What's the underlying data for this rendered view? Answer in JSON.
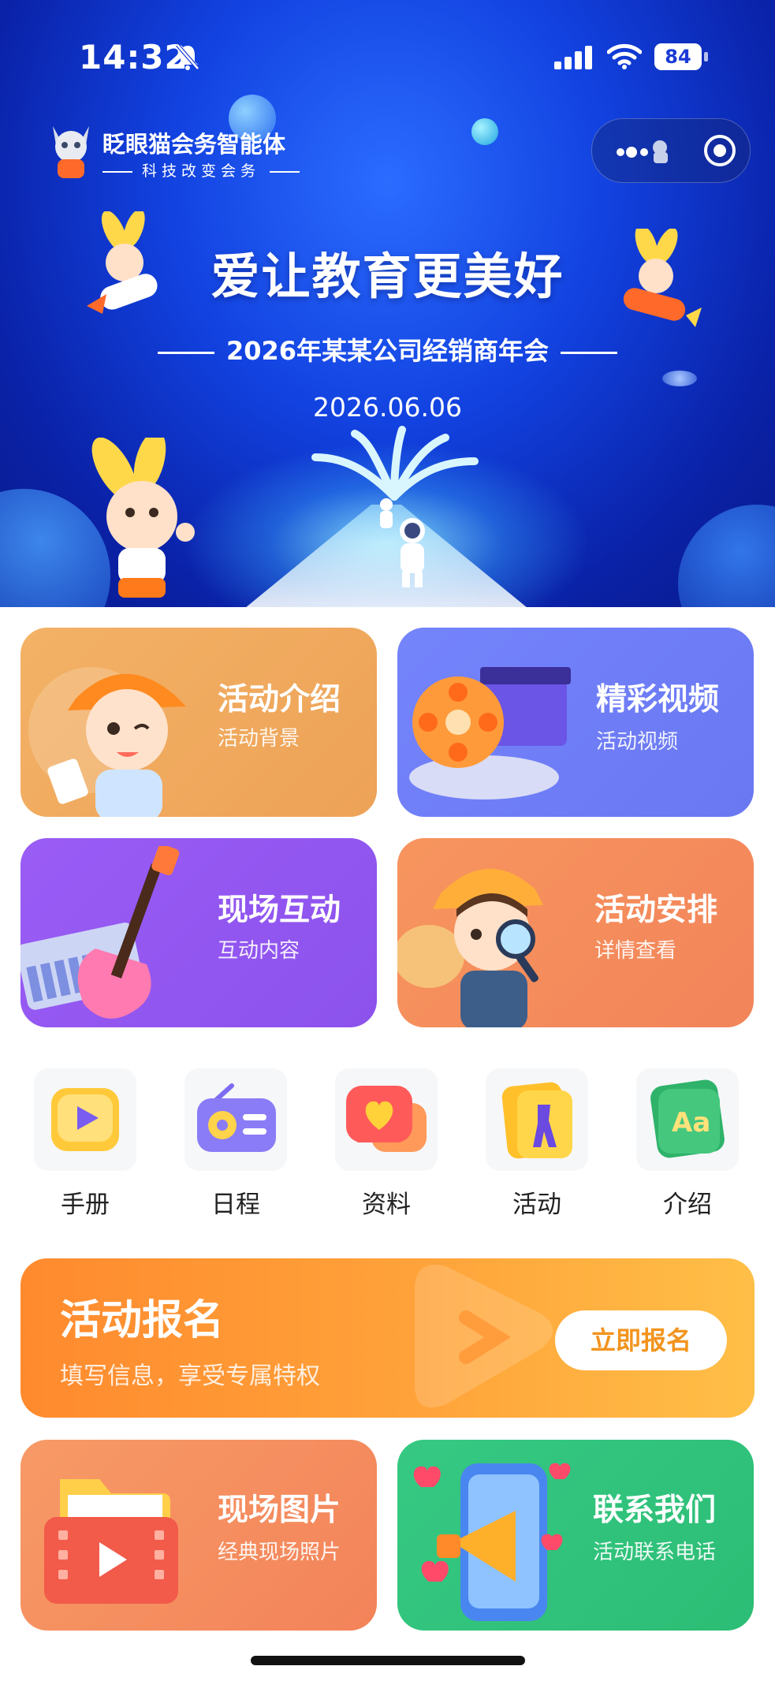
{
  "status_bar": {
    "time": "14:32",
    "battery": "84"
  },
  "brand": {
    "name": "眨眼猫会务智能体",
    "slogan": "科技改变会务"
  },
  "hero": {
    "title": "爱让教育更美好",
    "subtitle": "2026年某某公司经销商年会",
    "date": "2026.06.06"
  },
  "cards": [
    {
      "title": "活动介绍",
      "sub": "活动背景",
      "color": "#f2a85c"
    },
    {
      "title": "精彩视频",
      "sub": "活动视频",
      "color": "#6f7ff5"
    },
    {
      "title": "现场互动",
      "sub": "互动内容",
      "color": "#8e5af2"
    },
    {
      "title": "活动安排",
      "sub": "详情查看",
      "color": "#f58e5c"
    }
  ],
  "grid": [
    {
      "label": "手册",
      "icon": "video-book-icon"
    },
    {
      "label": "日程",
      "icon": "radio-icon"
    },
    {
      "label": "资料",
      "icon": "heart-chat-icon"
    },
    {
      "label": "活动",
      "icon": "giraffe-icon"
    },
    {
      "label": "介绍",
      "icon": "letters-aa-icon"
    }
  ],
  "banner": {
    "title": "活动报名",
    "sub": "填写信息，享受专属特权",
    "button": "立即报名"
  },
  "bottom_cards": [
    {
      "title": "现场图片",
      "sub": "经典现场照片",
      "color": "#f58a5c"
    },
    {
      "title": "联系我们",
      "sub": "活动联系电话",
      "color": "#2fc27a"
    }
  ]
}
